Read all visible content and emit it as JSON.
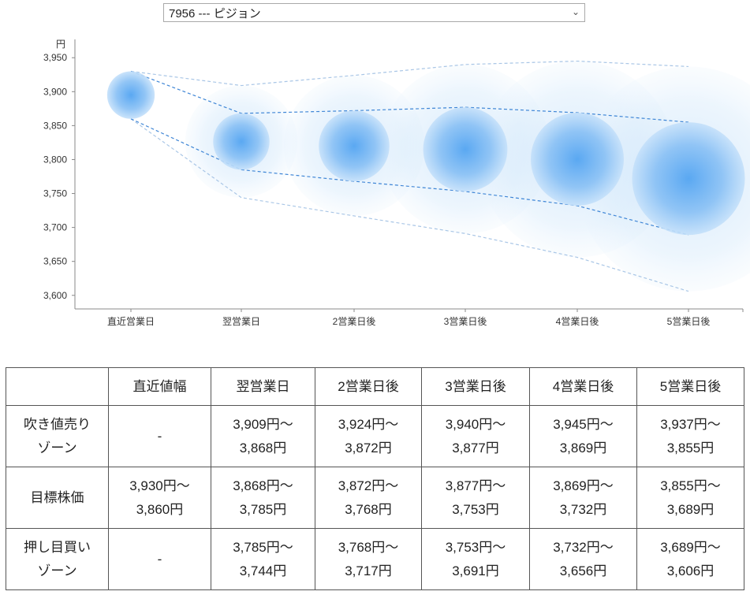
{
  "selector": {
    "value": "7956 --- ピジョン"
  },
  "chart_data": {
    "type": "bubble-range",
    "y_unit": "円",
    "categories": [
      "直近営業日",
      "翌営業日",
      "2営業日後",
      "3営業日後",
      "4営業日後",
      "5営業日後"
    ],
    "ylim": [
      3580,
      3970
    ],
    "yticks": [
      3600,
      3650,
      3700,
      3750,
      3800,
      3850,
      3900,
      3950
    ],
    "ytick_labels": [
      "3,600",
      "3,650",
      "3,700",
      "3,750",
      "3,800",
      "3,850",
      "3,900",
      "3,950"
    ],
    "grid": false,
    "target": [
      {
        "high": 3930,
        "low": 3860
      },
      {
        "high": 3868,
        "low": 3785
      },
      {
        "high": 3872,
        "low": 3768
      },
      {
        "high": 3877,
        "low": 3753
      },
      {
        "high": 3869,
        "low": 3732
      },
      {
        "high": 3855,
        "low": 3689
      }
    ],
    "sell_zone": [
      null,
      {
        "high": 3909,
        "low": 3868
      },
      {
        "high": 3924,
        "low": 3872
      },
      {
        "high": 3940,
        "low": 3877
      },
      {
        "high": 3945,
        "low": 3869
      },
      {
        "high": 3937,
        "low": 3855
      }
    ],
    "buy_zone": [
      null,
      {
        "high": 3785,
        "low": 3744
      },
      {
        "high": 3768,
        "low": 3717
      },
      {
        "high": 3753,
        "low": 3691
      },
      {
        "high": 3732,
        "low": 3656
      },
      {
        "high": 3689,
        "low": 3606
      }
    ],
    "colors": {
      "bubble": "#4a9ff0",
      "halo": "#cfe6fb",
      "dash": "#3f86d6",
      "dash_outer": "#a9c6e6",
      "axis": "#888888"
    }
  },
  "table": {
    "headers": [
      "",
      "直近値幅",
      "翌営業日",
      "2営業日後",
      "3営業日後",
      "4営業日後",
      "5営業日後"
    ],
    "rows": [
      {
        "label1": "吹き値売り",
        "label2": "ゾーン",
        "cells": [
          {
            "line1": "-",
            "line2": ""
          },
          {
            "line1": "3,909円～",
            "line2": "3,868円"
          },
          {
            "line1": "3,924円～",
            "line2": "3,872円"
          },
          {
            "line1": "3,940円～",
            "line2": "3,877円"
          },
          {
            "line1": "3,945円～",
            "line2": "3,869円"
          },
          {
            "line1": "3,937円～",
            "line2": "3,855円"
          }
        ]
      },
      {
        "label1": "目標株価",
        "label2": "",
        "cells": [
          {
            "line1": "3,930円～",
            "line2": "3,860円"
          },
          {
            "line1": "3,868円～",
            "line2": "3,785円"
          },
          {
            "line1": "3,872円～",
            "line2": "3,768円"
          },
          {
            "line1": "3,877円～",
            "line2": "3,753円"
          },
          {
            "line1": "3,869円～",
            "line2": "3,732円"
          },
          {
            "line1": "3,855円～",
            "line2": "3,689円"
          }
        ]
      },
      {
        "label1": "押し目買い",
        "label2": "ゾーン",
        "cells": [
          {
            "line1": "-",
            "line2": ""
          },
          {
            "line1": "3,785円～",
            "line2": "3,744円"
          },
          {
            "line1": "3,768円～",
            "line2": "3,717円"
          },
          {
            "line1": "3,753円～",
            "line2": "3,691円"
          },
          {
            "line1": "3,732円～",
            "line2": "3,656円"
          },
          {
            "line1": "3,689円～",
            "line2": "3,606円"
          }
        ]
      }
    ]
  }
}
